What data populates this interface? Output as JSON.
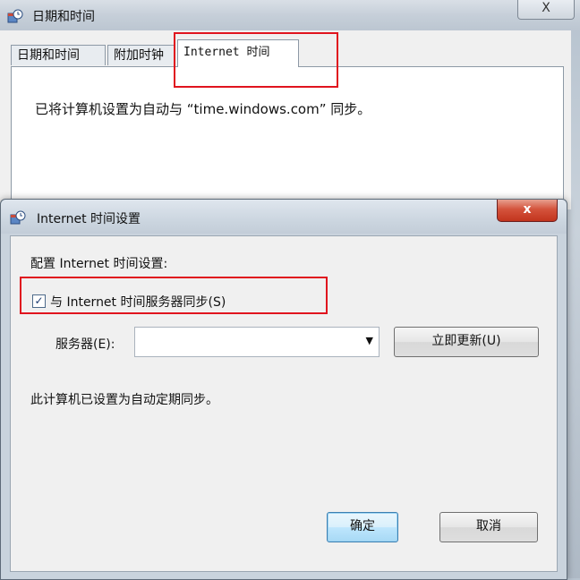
{
  "parent_window": {
    "title": "日期和时间",
    "close_glyph": "X",
    "tabs": [
      {
        "label": "日期和时间"
      },
      {
        "label": "附加时钟"
      },
      {
        "label": "Internet 时间"
      }
    ],
    "status_text": "已将计算机设置为自动与 “time.windows.com” 同步。"
  },
  "dialog": {
    "title": "Internet 时间设置",
    "close_glyph": "x",
    "section_heading": "配置 Internet 时间设置:",
    "sync_checkbox": {
      "label": "与 Internet 时间服务器同步(S)",
      "checked": true
    },
    "server": {
      "label": "服务器(E):",
      "value": ""
    },
    "update_now_label": "立即更新(U)",
    "info_text": "此计算机已设置为自动定期同步。",
    "ok_label": "确定",
    "cancel_label": "取消"
  },
  "colors": {
    "highlight_box": "#e0141e",
    "close_button": "#c9432c"
  }
}
